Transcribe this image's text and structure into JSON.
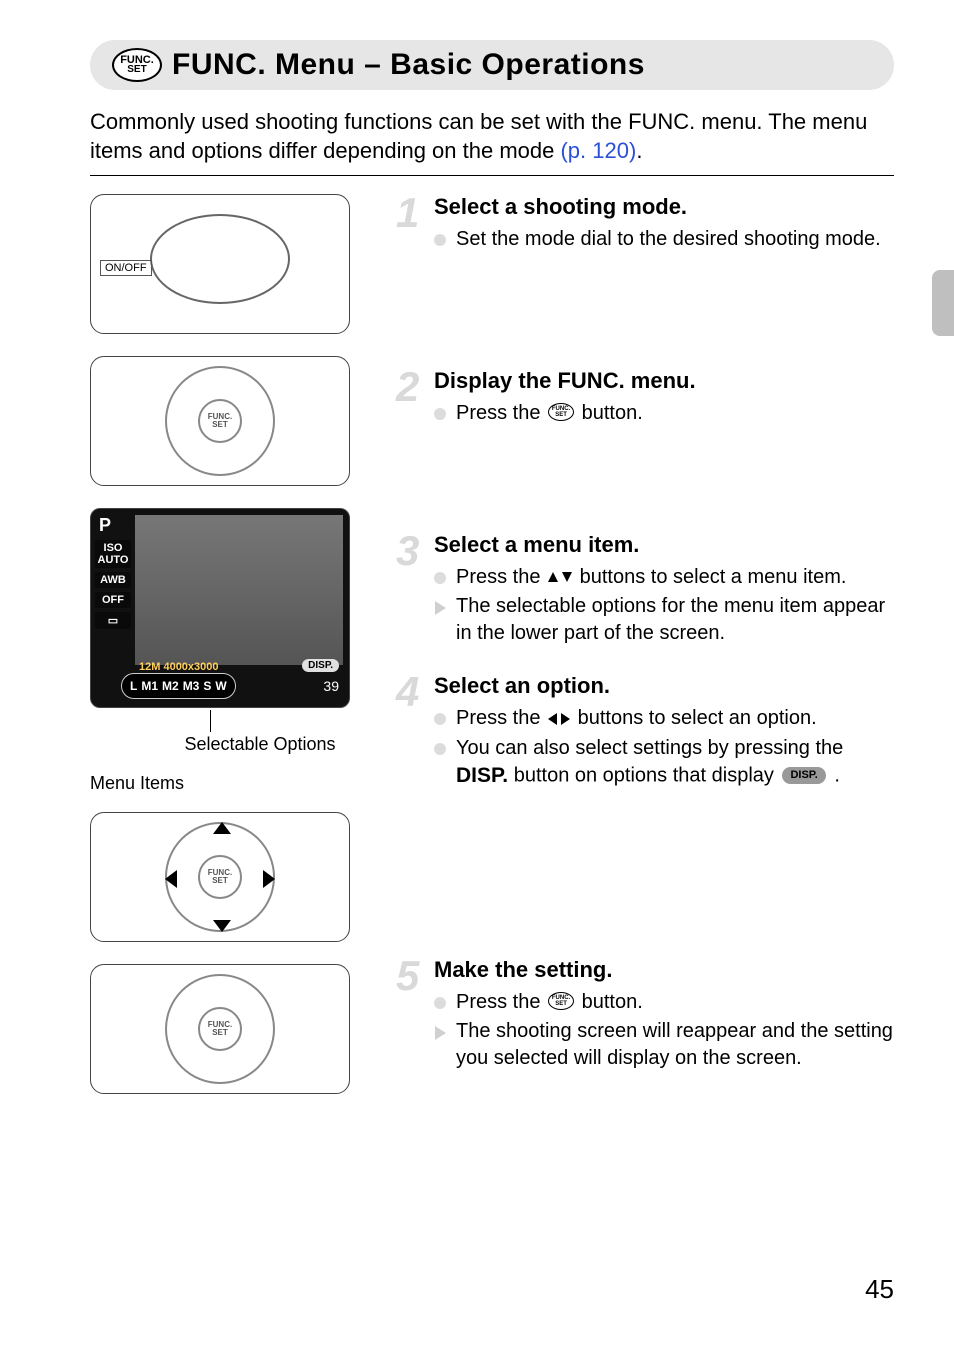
{
  "header": {
    "func_top": "FUNC.",
    "func_bot": "SET",
    "title": "FUNC. Menu – Basic Operations"
  },
  "intro": {
    "text_a": "Commonly used shooting functions can be set with the FUNC. menu. The menu items and options differ depending on the mode ",
    "link": "(p. 120)",
    "text_b": "."
  },
  "screenshot": {
    "p_label": "P",
    "iso": "ISO AUTO",
    "awb": "AWB",
    "off": "OFF",
    "resolution": "12M 4000x3000",
    "disp_tag": "DISP.",
    "options": [
      "L",
      "M1",
      "M2",
      "M3",
      "S",
      "W"
    ],
    "shots": "39"
  },
  "callouts": {
    "selectable_options": "Selectable Options",
    "menu_items": "Menu Items"
  },
  "onoff": "ON/OFF",
  "steps": [
    {
      "num": "1",
      "title": "Select a shooting mode.",
      "items": [
        {
          "kind": "dot",
          "text": "Set the mode dial to the desired shooting mode."
        }
      ]
    },
    {
      "num": "2",
      "title": "Display the FUNC. menu.",
      "items": [
        {
          "kind": "dot",
          "pre": "Press the ",
          "btn": "func",
          "post": " button."
        }
      ]
    },
    {
      "num": "3",
      "title": "Select a menu item.",
      "items": [
        {
          "kind": "dot",
          "pre": "Press the ",
          "btn": "updown",
          "post": " buttons to select a menu item."
        },
        {
          "kind": "tri",
          "text": "The selectable options for the menu item appear in the lower part of the screen."
        }
      ]
    },
    {
      "num": "4",
      "title": "Select an option.",
      "items": [
        {
          "kind": "dot",
          "pre": "Press the ",
          "btn": "leftright",
          "post": " buttons to select an option."
        },
        {
          "kind": "dot",
          "pre": "You can also select settings by pressing the ",
          "btn": "dispbold",
          "post": " button on options that display ",
          "chip": "DISP.",
          "tail": " ."
        }
      ]
    },
    {
      "num": "5",
      "title": "Make the setting.",
      "items": [
        {
          "kind": "dot",
          "pre": "Press the ",
          "btn": "func",
          "post": " button."
        },
        {
          "kind": "tri",
          "text": "The shooting screen will reappear and the setting you selected will display on the screen."
        }
      ]
    }
  ],
  "disp_bold": "DISP.",
  "page_number": "45"
}
